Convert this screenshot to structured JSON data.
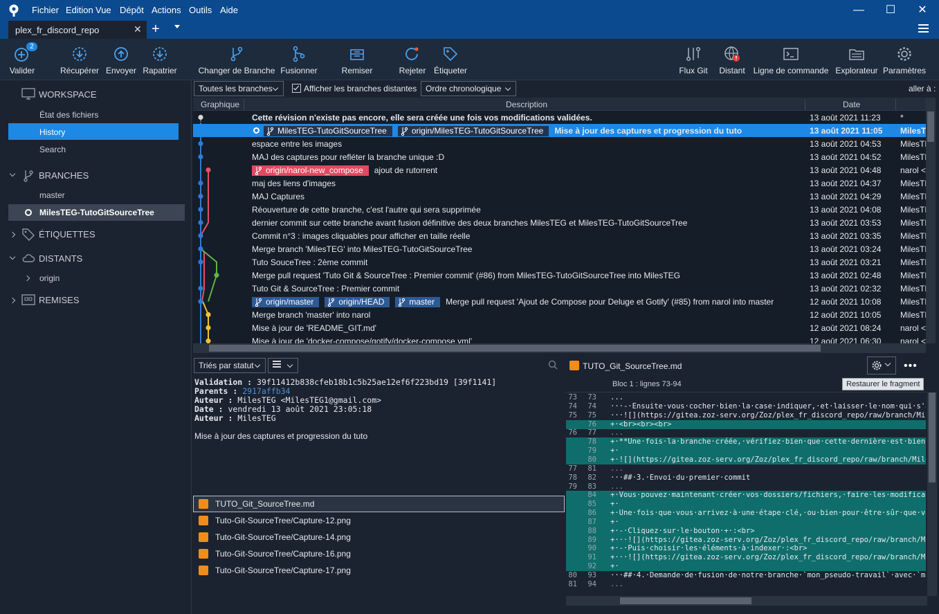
{
  "app": {
    "menu": [
      "Fichier",
      "Edition",
      "Vue",
      "Dépôt",
      "Actions",
      "Outils",
      "Aide"
    ],
    "tab_title": "plex_fr_discord_repo"
  },
  "toolbar": {
    "left": [
      {
        "label": "Valider",
        "badge": "2",
        "icon": "commit-icon"
      },
      {
        "label": "Récupérer",
        "icon": "fetch-icon"
      },
      {
        "label": "Envoyer",
        "icon": "push-icon"
      },
      {
        "label": "Rapatrier",
        "icon": "pull-icon"
      },
      {
        "label": "Changer de Branche",
        "icon": "branch-checkout-icon"
      },
      {
        "label": "Fusionner",
        "icon": "merge-icon"
      },
      {
        "label": "Remiser",
        "icon": "stash-icon"
      },
      {
        "label": "Rejeter",
        "icon": "discard-icon"
      },
      {
        "label": "Étiqueter",
        "icon": "tag-icon"
      }
    ],
    "right": [
      {
        "label": "Flux Git",
        "icon": "git-flow-icon"
      },
      {
        "label": "Distant",
        "icon": "remote-globe-icon"
      },
      {
        "label": "Ligne de commande",
        "icon": "terminal-icon"
      },
      {
        "label": "Explorateur",
        "icon": "folder-icon"
      },
      {
        "label": "Paramètres",
        "icon": "gear-icon"
      }
    ]
  },
  "sidebar": {
    "workspace": {
      "title": "WORKSPACE",
      "items": [
        "État des fichiers",
        "History",
        "Search"
      ],
      "selected": "History"
    },
    "branches": {
      "title": "BRANCHES",
      "items": [
        "master",
        "MilesTEG-TutoGitSourceTree"
      ],
      "current": "MilesTEG-TutoGitSourceTree"
    },
    "tags": {
      "title": "ÉTIQUETTES"
    },
    "remotes": {
      "title": "DISTANTS",
      "items": [
        "origin"
      ]
    },
    "stashes": {
      "title": "REMISES"
    }
  },
  "filters": {
    "branches": "Toutes les branches",
    "show_remote_label": "Afficher les branches distantes",
    "show_remote_checked": true,
    "order": "Ordre chronologique",
    "goto": "aller à :"
  },
  "columns": {
    "graph": "Graphique",
    "description": "Description",
    "date": "Date"
  },
  "commits": [
    {
      "desc": "Cette révision n'existe pas encore, elle sera créée une fois vos modifications validées.",
      "date": "13 août 2021 11:23",
      "author": "*",
      "bold": true
    },
    {
      "desc": "Mise à jour des captures et progression du tuto",
      "date": "13 août 2021 11:05",
      "author": "MilesTEG",
      "selected": true,
      "head": true,
      "tags": [
        {
          "label": "MilesTEG-TutoGitSourceTree",
          "color": "dark"
        },
        {
          "label": "origin/MilesTEG-TutoGitSourceTree",
          "color": "dark"
        }
      ]
    },
    {
      "desc": "espace entre les images",
      "date": "13 août 2021 04:53",
      "author": "MilesTEG"
    },
    {
      "desc": "MAJ des captures pour refléter la branche unique :D",
      "date": "13 août 2021 04:52",
      "author": "MilesTEG"
    },
    {
      "desc": "ajout de rutorrent",
      "date": "13 août 2021 04:48",
      "author": "narol <",
      "tags": [
        {
          "label": "origin/narol-new_compose",
          "color": "red"
        }
      ]
    },
    {
      "desc": "maj des liens d'images",
      "date": "13 août 2021 04:37",
      "author": "MilesTEG"
    },
    {
      "desc": "MAJ Captures",
      "date": "13 août 2021 04:29",
      "author": "MilesTEG"
    },
    {
      "desc": "Réouverture de cette branche, c'est l'autre qui sera supprimée",
      "date": "13 août 2021 04:08",
      "author": "MilesTEG"
    },
    {
      "desc": "dernier commit sur cette branche avant fusion définitive des deux branches MilesTEG et MilesTEG-TutoGitSourceTree",
      "date": "13 août 2021 03:53",
      "author": "MilesTEG"
    },
    {
      "desc": "Commit n°3 : images cliquables pour afficher en taille réelle",
      "date": "13 août 2021 03:35",
      "author": "MilesTEG"
    },
    {
      "desc": "Merge branch 'MilesTEG' into MilesTEG-TutoGitSourceTree",
      "date": "13 août 2021 03:24",
      "author": "MilesTEG"
    },
    {
      "desc": "Tuto SouceTree : 2ème commit",
      "date": "13 août 2021 03:21",
      "author": "MilesTEG"
    },
    {
      "desc": "Merge pull request 'Tuto Git & SourceTree : Premier commit' (#86) from MilesTEG-TutoGitSourceTree into MilesTEG",
      "date": "13 août 2021 02:48",
      "author": "MilesTEG"
    },
    {
      "desc": "Tuto Git & SourceTree : Premier commit",
      "date": "13 août 2021 02:32",
      "author": "MilesTEG"
    },
    {
      "desc": "Merge pull request 'Ajout de Compose pour Deluge et Gotify' (#85) from narol into master",
      "date": "12 août 2021 10:08",
      "author": "MilesTEG",
      "tags": [
        {
          "label": "origin/master",
          "color": "blue"
        },
        {
          "label": "origin/HEAD",
          "color": "blue"
        },
        {
          "label": "master",
          "color": "blue"
        }
      ]
    },
    {
      "desc": "Merge branch 'master' into narol",
      "date": "12 août 2021 10:05",
      "author": "MilesTEG"
    },
    {
      "desc": "Mise à jour de 'README_GIT.md'",
      "date": "12 août 2021 08:24",
      "author": "narol <"
    },
    {
      "desc": "Mise à jour de 'docker-compose/gotify/docker-compose.yml'",
      "date": "12 août 2021 06:30",
      "author": "narol <"
    }
  ],
  "details": {
    "sort": "Triés par statut",
    "validation_label": "Validation :",
    "validation": "39f11412b838cfeb18b1c5b25ae12ef6f223bd19 [39f1141]",
    "parents_label": "Parents :",
    "parents": "2917affb34",
    "author_label": "Auteur :",
    "author": "MilesTEG <MilesTEG1@gmail.com>",
    "date_label": "Date :",
    "date": "vendredi 13 août 2021 23:05:18",
    "committer_label": "Auteur :",
    "committer": "MilesTEG",
    "message": "Mise à jour des captures et progression du tuto",
    "files": [
      "TUTO_Git_SourceTree.md",
      "Tuto-Git-SourceTree/Capture-12.png",
      "Tuto-Git-SourceTree/Capture-14.png",
      "Tuto-Git-SourceTree/Capture-16.png",
      "Tuto-Git-SourceTree/Capture-17.png"
    ]
  },
  "diff": {
    "file": "TUTO_Git_SourceTree.md",
    "hunk": "Bloc 1 : lignes 73-94",
    "restore": "Restaurer le fragment",
    "lines": [
      {
        "o": "73",
        "n": "73",
        "t": "...",
        "k": "ctx"
      },
      {
        "o": "74",
        "n": "74",
        "t": "···-·Ensuite·vous·cocher·bien·la·case·indiquer,·et·laisser·le·nom·qui·s'affi",
        "k": "ctx"
      },
      {
        "o": "75",
        "n": "75",
        "t": "···![](https://gitea.zoz-serv.org/Zoz/plex_fr_discord_repo/raw/branch/MilesT",
        "k": "ctx"
      },
      {
        "o": "",
        "n": "76",
        "t": "+·<br><br><br>",
        "k": "add",
        "html": true
      },
      {
        "o": "76",
        "n": "77",
        "t": "...",
        "k": "ell"
      },
      {
        "o": "",
        "n": "78",
        "t": "+·**Une·fois·la·branche·créée,·vérifiez·bien·que·cette·dernière·est·bien·sé",
        "k": "add"
      },
      {
        "o": "",
        "n": "79",
        "t": "+·",
        "k": "add"
      },
      {
        "o": "",
        "n": "80",
        "t": "+·![](https://gitea.zoz-serv.org/Zoz/plex_fr_discord_repo/raw/branch/MilesT",
        "k": "add"
      },
      {
        "o": "77",
        "n": "81",
        "t": "...",
        "k": "ell"
      },
      {
        "o": "78",
        "n": "82",
        "t": "···##·3.·Envoi·du·premier·commit",
        "k": "ctx"
      },
      {
        "o": "79",
        "n": "83",
        "t": "...",
        "k": "ell"
      },
      {
        "o": "",
        "n": "84",
        "t": "+·Vous·pouvez·maintenant·créer·vos·dossiers/fichiers,·faire·les·modificatio",
        "k": "add"
      },
      {
        "o": "",
        "n": "85",
        "t": "+·",
        "k": "add"
      },
      {
        "o": "",
        "n": "86",
        "t": "+·Une·fois·que·vous·arrivez·à·une·étape·clé,·ou·bien·pour·être·sûr·que·votr",
        "k": "add"
      },
      {
        "o": "",
        "n": "87",
        "t": "+·",
        "k": "add"
      },
      {
        "o": "",
        "n": "88",
        "t": "+·-·Cliquez·sur·le·bouton·+·:<br>",
        "k": "add",
        "html": true
      },
      {
        "o": "",
        "n": "89",
        "t": "+···![](https://gitea.zoz-serv.org/Zoz/plex_fr_discord_repo/raw/branch/Mile",
        "k": "add"
      },
      {
        "o": "",
        "n": "90",
        "t": "+·-·Puis·choisir·les·éléments·à·indexer·:<br>",
        "k": "add",
        "html": true
      },
      {
        "o": "",
        "n": "91",
        "t": "+···![](https://gitea.zoz-serv.org/Zoz/plex_fr_discord_repo/raw/branch/Mile",
        "k": "add"
      },
      {
        "o": "",
        "n": "92",
        "t": "+·",
        "k": "add"
      },
      {
        "o": "80",
        "n": "93",
        "t": "···##·4.·Demande·de·fusion·de·notre·branche·`mon_pseudo-travail`·avec·`maste",
        "k": "ctx"
      },
      {
        "o": "81",
        "n": "94",
        "t": "...",
        "k": "ell"
      }
    ]
  },
  "colors": {
    "accent": "#1e88e5",
    "titlebar": "#0b4a8e",
    "graph_blue": "#2e7bd6",
    "graph_red": "#e94e66",
    "graph_green": "#5fb443",
    "graph_yellow": "#f2c12e",
    "added": "#0f6e6b"
  }
}
